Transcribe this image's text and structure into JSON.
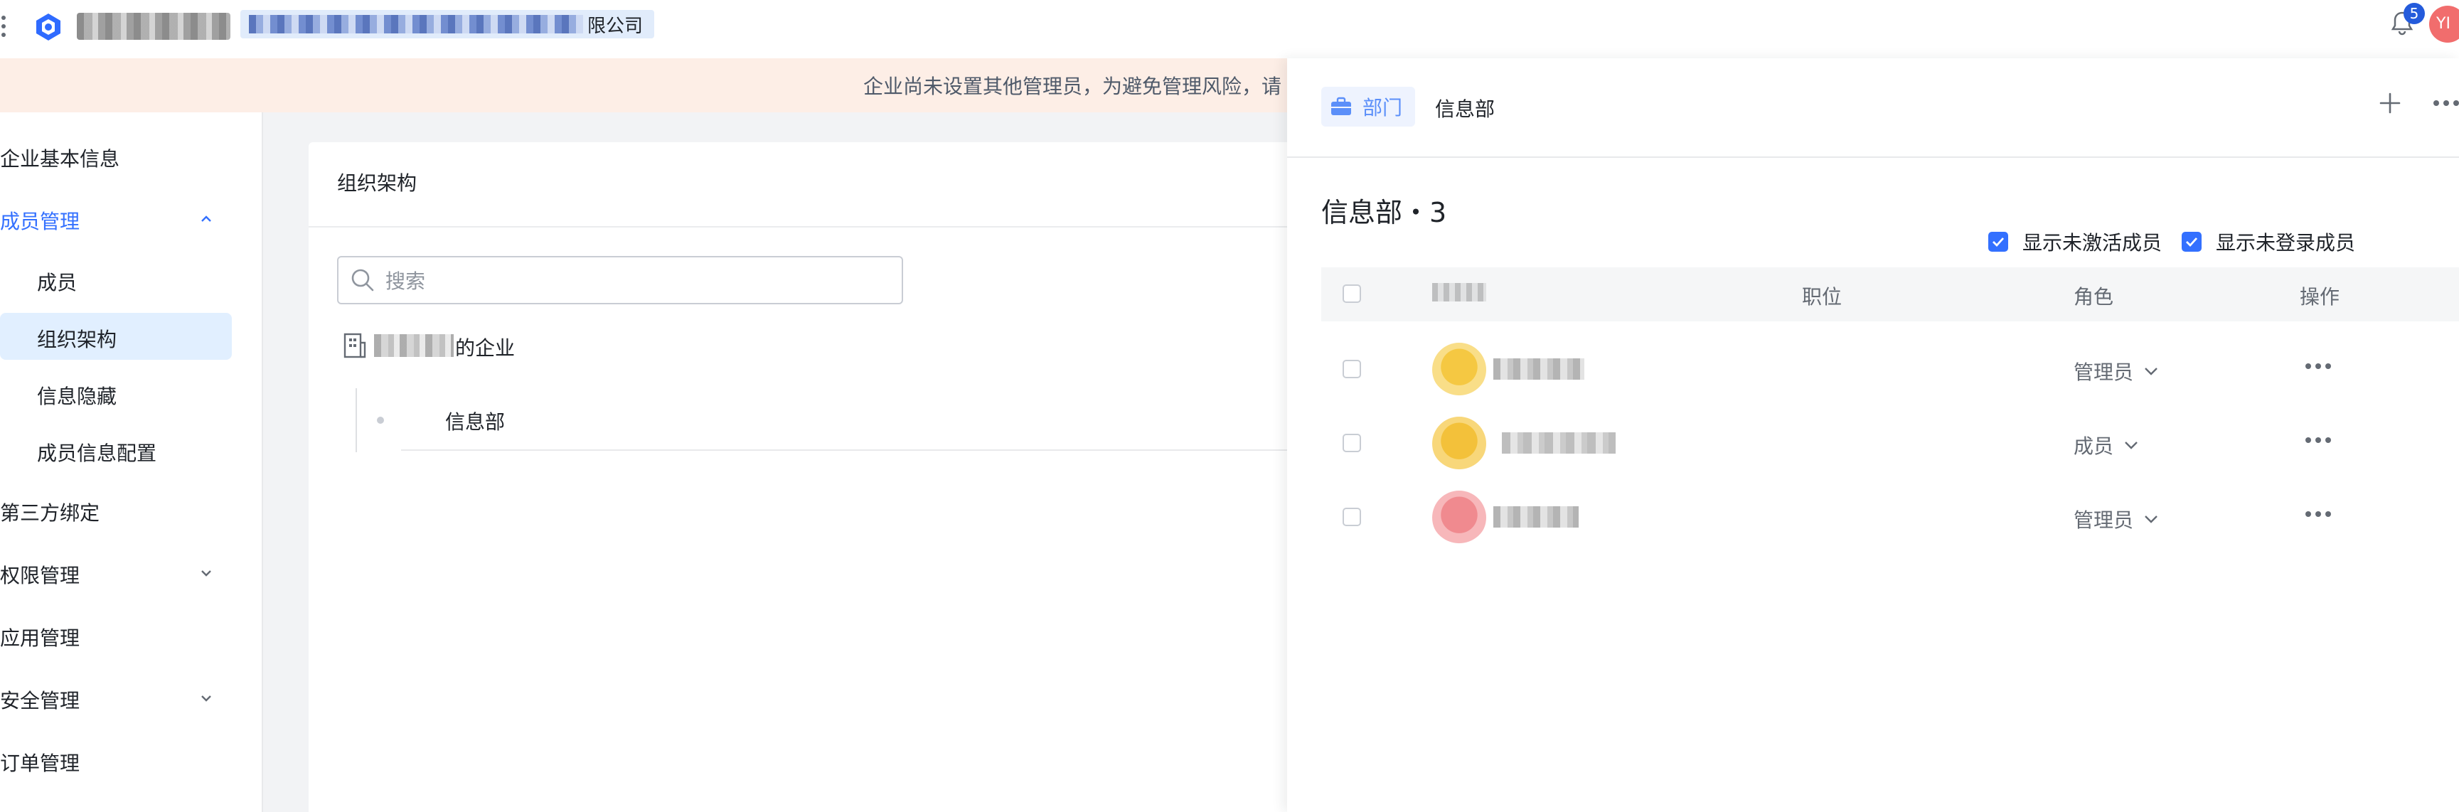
{
  "company": {
    "name_suffix": "限公司"
  },
  "notifications": {
    "count": "5"
  },
  "user": {
    "avatar_text": "YI"
  },
  "notice": {
    "text": "企业尚未设置其他管理员，为避免管理风险，请"
  },
  "sidebar": {
    "items": [
      {
        "label": "企业基本信息"
      },
      {
        "label": "成员管理",
        "expanded": true
      },
      {
        "label": "成员"
      },
      {
        "label": "组织架构",
        "selected": true
      },
      {
        "label": "信息隐藏"
      },
      {
        "label": "成员信息配置"
      },
      {
        "label": "第三方绑定"
      },
      {
        "label": "权限管理"
      },
      {
        "label": "应用管理"
      },
      {
        "label": "安全管理"
      },
      {
        "label": "订单管理"
      }
    ]
  },
  "org": {
    "title": "组织架构",
    "search_placeholder": "搜索",
    "enterprise_suffix": "的企业",
    "departments": [
      {
        "name": "信息部"
      }
    ]
  },
  "panel": {
    "tag": "部门",
    "dept_name": "信息部",
    "title": "信息部・3",
    "filters": [
      {
        "label": "显示未激活成员",
        "checked": true
      },
      {
        "label": "显示未登录成员",
        "checked": true
      }
    ],
    "columns": {
      "position": "职位",
      "role": "角色",
      "actions": "操作"
    },
    "members": [
      {
        "role": "管理员",
        "avatar_color": "#f5c842"
      },
      {
        "role": "成员",
        "avatar_color": "#f3c13a"
      },
      {
        "role": "管理员",
        "avatar_color": "#f08a8f"
      }
    ]
  },
  "colors": {
    "accent": "#3370ff",
    "notice_bg": "#fdeee6",
    "selected_bg": "#e1efff"
  }
}
